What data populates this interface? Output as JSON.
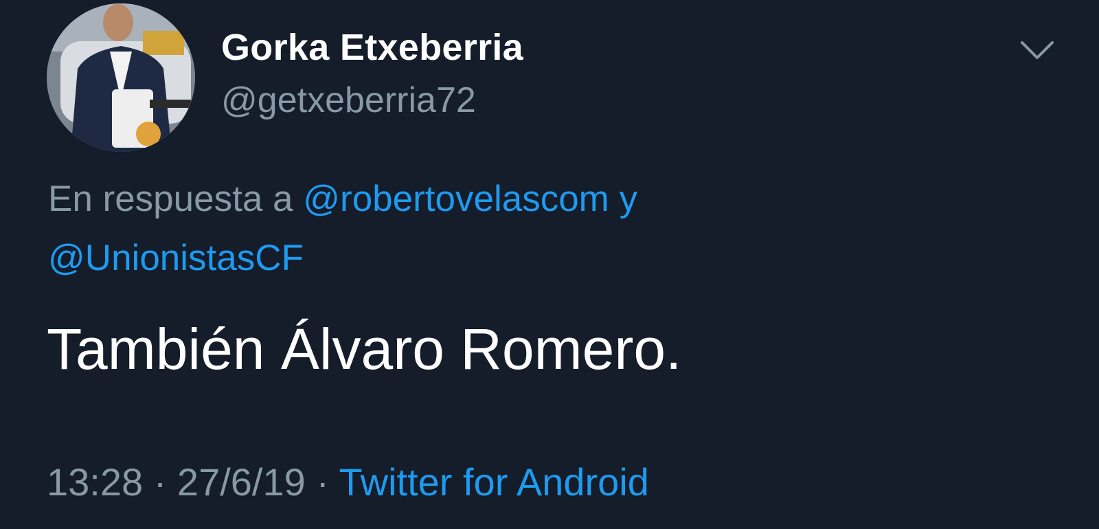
{
  "author": {
    "display_name": "Gorka Etxeberria",
    "handle": "@getxeberria72"
  },
  "reply_context": {
    "prefix": "En respuesta a",
    "mention_1": "@robertovelascom",
    "conjunction": "y",
    "mention_2": "@UnionistasCF"
  },
  "tweet": {
    "text": "También Álvaro Romero."
  },
  "meta": {
    "time": "13:28",
    "separator_1": "·",
    "date": "27/6/19",
    "separator_2": "·",
    "source": "Twitter for Android"
  },
  "icons": {
    "menu": "chevron-down-icon"
  },
  "colors": {
    "background": "#151c2a",
    "text": "#ffffff",
    "muted": "#8899a6",
    "link": "#1d9bf0"
  }
}
